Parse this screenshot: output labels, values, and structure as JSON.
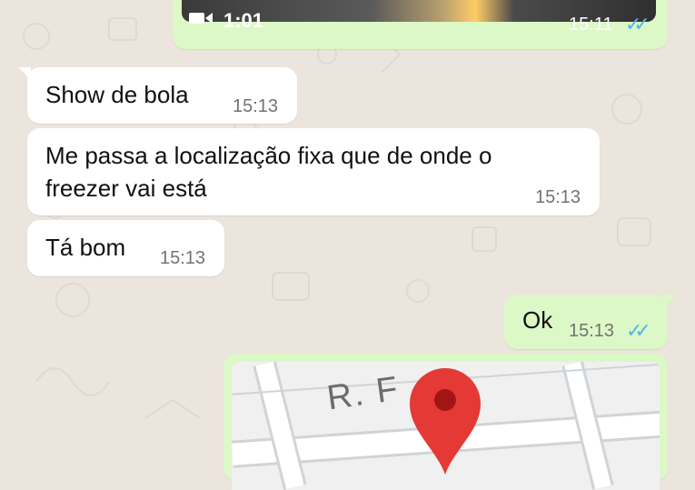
{
  "conversation": {
    "messages": [
      {
        "type": "video",
        "direction": "outgoing",
        "duration": "1:01",
        "time": "15:11",
        "status_icon": "double-check-read-icon"
      },
      {
        "type": "text",
        "direction": "incoming",
        "text": "Show de bola",
        "time": "15:13"
      },
      {
        "type": "text",
        "direction": "incoming",
        "text_line1": "Me passa a localização fixa que de onde o",
        "text_line2": "freezer vai está",
        "time": "15:13"
      },
      {
        "type": "text",
        "direction": "incoming",
        "text": "Tá bom",
        "time": "15:13"
      },
      {
        "type": "text",
        "direction": "outgoing",
        "text": "Ok",
        "time": "15:13",
        "status_icon": "double-check-read-icon"
      },
      {
        "type": "location",
        "direction": "outgoing",
        "street_label": "R. F"
      }
    ]
  },
  "colors": {
    "chat_background": "#ece5dd",
    "incoming_bubble": "#ffffff",
    "outgoing_bubble": "#dcf8c6",
    "read_ticks": "#4fb6ec",
    "map_pin": "#e53935"
  }
}
